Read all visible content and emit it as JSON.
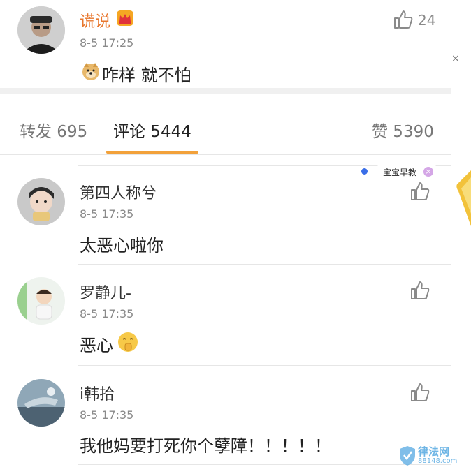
{
  "top_comment": {
    "user": "谎说",
    "time": "8-5 17:25",
    "content": "咋样 就不怕",
    "likes": "24",
    "badge_icon": "crown-badge-icon",
    "emoji_icon": "doge-emoji-icon"
  },
  "close_symbol": "×",
  "tabs": [
    {
      "label": "转发 695"
    },
    {
      "label": "评论 5444"
    },
    {
      "label": "赞 5390"
    }
  ],
  "active_tab_color": "#f2a13a",
  "ad": {
    "label": "宝宝早教",
    "close_symbol": "×"
  },
  "comments": [
    {
      "user": "第四人称兮",
      "time": "8-5 17:35",
      "content": "太恶心啦你"
    },
    {
      "user": "罗静儿-",
      "time": "8-5 17:35",
      "content": "恶心",
      "emoji_icon": "shush-emoji-icon"
    },
    {
      "user": "i韩拾",
      "time": "8-5 17:35",
      "content": "我他妈要打死你个孽障！！！！！"
    }
  ],
  "watermark": {
    "text": "律法网",
    "subtext": "88148.com"
  }
}
